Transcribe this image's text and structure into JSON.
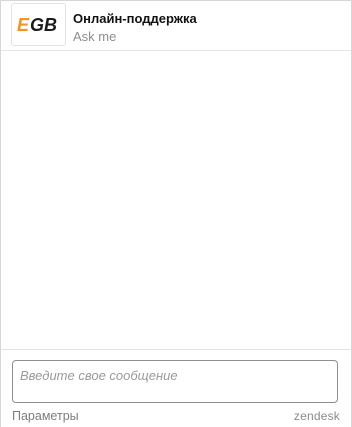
{
  "header": {
    "logo": {
      "text": "EGB",
      "icon": "egb-logo",
      "colors": {
        "e": "#f7941d",
        "gb": "#1a1a1a"
      }
    },
    "title": "Онлайн-поддержка",
    "subtitle": "Ask me"
  },
  "composer": {
    "placeholder": "Введите свое сообщение",
    "value": ""
  },
  "footer": {
    "settings_label": "Параметры",
    "brand_label": "zendesk"
  }
}
